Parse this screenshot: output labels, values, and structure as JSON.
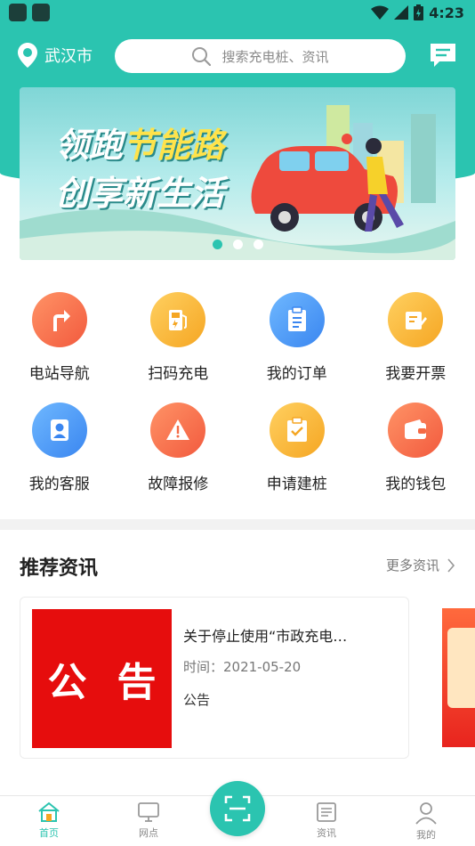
{
  "status": {
    "time": "4:23"
  },
  "header": {
    "city": "武汉市",
    "search_placeholder": "搜索充电桩、资讯"
  },
  "banner": {
    "line1_a": "领跑",
    "line1_b": "节能路",
    "line2": "创享新生活",
    "active_slide": 1,
    "slide_count": 3
  },
  "grid": [
    {
      "label": "电站导航",
      "icon": "navigation-turn-icon",
      "color": "#f46a45"
    },
    {
      "label": "扫码充电",
      "icon": "fuel-pump-icon",
      "color": "#f5a623"
    },
    {
      "label": "我的订单",
      "icon": "clipboard-icon",
      "color": "#3a86f0"
    },
    {
      "label": "我要开票",
      "icon": "invoice-edit-icon",
      "color": "#f5a623"
    },
    {
      "label": "我的客服",
      "icon": "customer-service-icon",
      "color": "#3a86f0"
    },
    {
      "label": "故障报修",
      "icon": "warning-icon",
      "color": "#f46a45"
    },
    {
      "label": "申请建桩",
      "icon": "application-check-icon",
      "color": "#f5a623"
    },
    {
      "label": "我的钱包",
      "icon": "wallet-icon",
      "color": "#f46a45"
    }
  ],
  "news_section": {
    "title": "推荐资讯",
    "more": "更多资讯"
  },
  "news": [
    {
      "thumb_left": "公",
      "thumb_right": "告",
      "title": "关于停止使用“市政充电…",
      "date": "时间：2021-05-20",
      "tag": "公告"
    }
  ],
  "tabs": [
    {
      "label": "首页",
      "icon": "home-icon",
      "active": true
    },
    {
      "label": "网点",
      "icon": "monitor-icon",
      "active": false
    },
    {
      "label": "资讯",
      "icon": "news-icon",
      "active": false
    },
    {
      "label": "我的",
      "icon": "user-icon",
      "active": false
    }
  ],
  "colors": {
    "accent": "#2bc4b0",
    "notice_red": "#e60d0d"
  }
}
